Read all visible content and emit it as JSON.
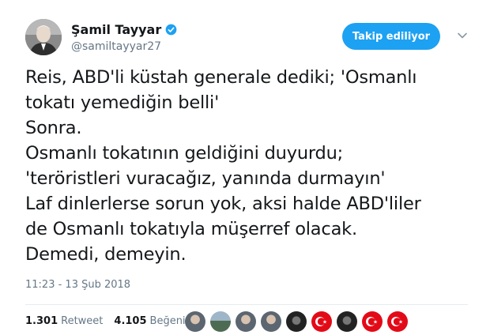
{
  "user": {
    "name": "Şamil Tayyar",
    "handle": "@samiltayyar27"
  },
  "follow_button": {
    "label": "Takip ediliyor"
  },
  "tweet": {
    "text": "Reis, ABD'li küstah generale dediki; 'Osmanlı\ntokatı yemediğin belli'\nSonra.\nOsmanlı tokatının geldiğini duyurdu;\n'teröristleri vuracağız, yanında durmayın'\nLaf dinlerlerse sorun yok, aksi halde ABD'liler\nde Osmanlı tokatıyla müşerref olacak.\nDemedi, demeyin.",
    "timestamp": "11:23 - 13 Şub 2018"
  },
  "stats": {
    "retweet_count": "1.301",
    "retweet_label": "Retweet",
    "like_count": "4.105",
    "like_label": "Beğeni"
  },
  "colors": {
    "accent": "#1da1f2",
    "verified": "#1da1f2",
    "secondary_text": "#657786"
  },
  "likers": [
    {
      "avatar": "person-photo"
    },
    {
      "avatar": "landscape-photo"
    },
    {
      "avatar": "person-photo"
    },
    {
      "avatar": "person-photo"
    },
    {
      "avatar": "dark-photo"
    },
    {
      "avatar": "turkish-flag"
    },
    {
      "avatar": "dark-photo"
    },
    {
      "avatar": "turkish-flag"
    },
    {
      "avatar": "turkish-flag"
    }
  ]
}
